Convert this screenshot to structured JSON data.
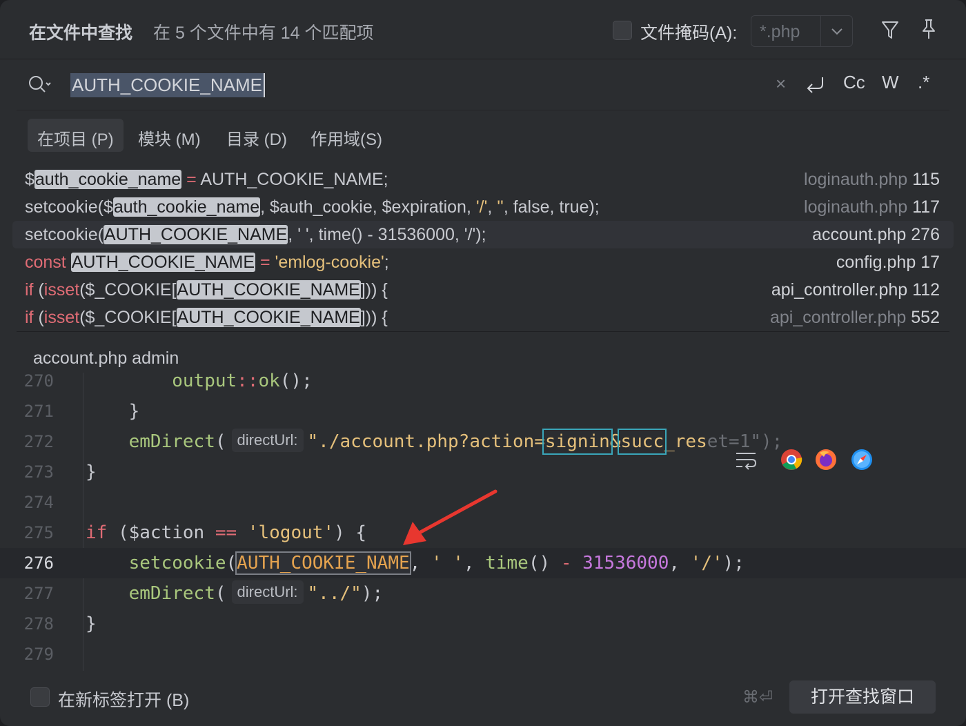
{
  "header": {
    "title": "在文件中查找",
    "match_count": "在 5 个文件中有 14 个匹配项",
    "file_mask_label": "文件掩码(A):",
    "file_mask_value": "*.php",
    "filter_icon": "filter-icon",
    "pin_icon": "pin-icon"
  },
  "search": {
    "query": "AUTH_COOKIE_NAME",
    "clear": "×",
    "newline": "⮐",
    "case": "Cc",
    "words": "W",
    "regex": ".*"
  },
  "scopes": [
    {
      "label": "在项目 (P)",
      "active": true
    },
    {
      "label": "模块 (M)",
      "active": false
    },
    {
      "label": "目录 (D)",
      "active": false
    },
    {
      "label": "作用域(S)",
      "active": false
    }
  ],
  "results": [
    {
      "code_pre": "$",
      "match": "auth_cookie_name",
      "code_post": " = AUTH_COOKIE_NAME;",
      "file": "loginauth.php",
      "line": "115",
      "dim": true
    },
    {
      "code_pre": "setcookie($",
      "match": "auth_cookie_name",
      "code_post": ", $auth_cookie, $expiration, '/', '', false, true);",
      "file": "loginauth.php",
      "line": "117",
      "dim": true
    },
    {
      "code_pre": "setcookie(",
      "match": "AUTH_COOKIE_NAME",
      "code_post": ", ' ', time() - 31536000, '/');",
      "file": "account.php",
      "line": "276",
      "dim": false
    },
    {
      "code_pre": "const ",
      "match": "AUTH_COOKIE_NAME",
      "code_post": " = 'emlog-cookie';",
      "file": "config.php",
      "line": "17",
      "dim": false
    },
    {
      "code_pre": "if (isset($_COOKIE[",
      "match": "AUTH_COOKIE_NAME",
      "code_post": "])) {",
      "file": "api_controller.php",
      "line": "112",
      "dim": false
    },
    {
      "code_pre": "if (isset($_COOKIE[",
      "match": "AUTH_COOKIE_NAME",
      "code_post": "])) {",
      "file": "api_controller.php",
      "line": "552",
      "dim": true
    }
  ],
  "preview": {
    "path": "account.php  admin",
    "lines": [
      {
        "n": "270",
        "text": "        output::ok();"
      },
      {
        "n": "271",
        "text": "    }"
      },
      {
        "n": "272",
        "text": "    emDirect( directUrl: \"./account.php?action=signin&succ_reset=1\");"
      },
      {
        "n": "273",
        "text": "}"
      },
      {
        "n": "274",
        "text": ""
      },
      {
        "n": "275",
        "text": "if ($action == 'logout') {"
      },
      {
        "n": "276",
        "text": "    setcookie(AUTH_COOKIE_NAME, ' ', time() - 31536000, '/');"
      },
      {
        "n": "277",
        "text": "    emDirect( directUrl: \"../\");"
      },
      {
        "n": "278",
        "text": "}"
      },
      {
        "n": "279",
        "text": ""
      }
    ],
    "hint_label": "directUrl:",
    "browsers": [
      "soft-wrap-icon",
      "chrome-icon",
      "firefox-icon",
      "safari-icon"
    ]
  },
  "footer": {
    "new_tab_label": "在新标签打开 (B)",
    "shortcut": "⌘⏎",
    "open_button": "打开查找窗口"
  },
  "colors": {
    "background": "#2b2d30",
    "keyword": "#e06c75",
    "string": "#e5c07b",
    "function": "#a9c77d",
    "number": "#c678dd",
    "constant": "#e5a34f",
    "arrow": "#e8372f"
  }
}
